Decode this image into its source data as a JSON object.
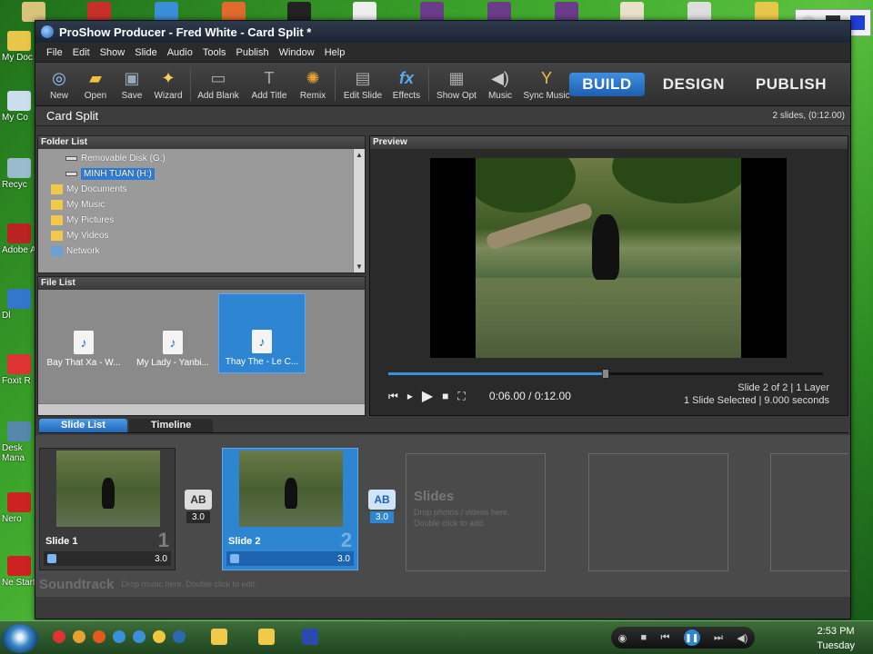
{
  "window": {
    "title": "ProShow Producer - Fred White - Card Split *"
  },
  "menu": [
    "File",
    "Edit",
    "Show",
    "Slide",
    "Audio",
    "Tools",
    "Publish",
    "Window",
    "Help"
  ],
  "toolbar": {
    "buttons": [
      {
        "label": "New",
        "icon": "new-disc-icon"
      },
      {
        "label": "Open",
        "icon": "folder-open-icon"
      },
      {
        "label": "Save",
        "icon": "floppy-save-icon"
      },
      {
        "label": "Wizard",
        "icon": "wizard-icon"
      },
      {
        "label": "Add Blank",
        "icon": "add-blank-icon"
      },
      {
        "label": "Add Title",
        "icon": "add-title-icon"
      },
      {
        "label": "Remix",
        "icon": "remix-icon"
      },
      {
        "label": "Edit Slide",
        "icon": "edit-slide-icon"
      },
      {
        "label": "Effects",
        "icon": "effects-fx-icon"
      },
      {
        "label": "Show Opt",
        "icon": "show-options-icon"
      },
      {
        "label": "Music",
        "icon": "music-speaker-icon"
      },
      {
        "label": "Sync Music",
        "icon": "sync-music-icon"
      }
    ],
    "modes": [
      "BUILD",
      "DESIGN",
      "PUBLISH"
    ],
    "active_mode": "BUILD"
  },
  "show": {
    "title": "Card Split",
    "info": "2 slides, (0:12.00)"
  },
  "folder_list": {
    "header": "Folder List",
    "items": [
      {
        "label": "Removable Disk (G:)",
        "icon": "drive-icon"
      },
      {
        "label": "MINH TUAN (H:)",
        "icon": "drive-icon",
        "selected": true
      },
      {
        "label": "My Documents",
        "icon": "folder-icon"
      },
      {
        "label": "My Music",
        "icon": "folder-icon"
      },
      {
        "label": "My Pictures",
        "icon": "folder-icon"
      },
      {
        "label": "My Videos",
        "icon": "folder-icon"
      },
      {
        "label": "Network",
        "icon": "network-icon"
      }
    ]
  },
  "file_list": {
    "header": "File List",
    "files": [
      {
        "name": "Bay That Xa - W...",
        "type": "MP3"
      },
      {
        "name": "My Lady - Yanbi...",
        "type": "MP3"
      },
      {
        "name": "Thay The - Le C...",
        "type": "MP3",
        "selected": true
      }
    ]
  },
  "preview": {
    "header": "Preview",
    "time": "0:06.00 / 0:12.00",
    "progress": 0.5,
    "slide_info": "Slide 2 of 2 | 1 Layer",
    "selection_info": "1 Slide Selected | 9.000 seconds"
  },
  "slide_list": {
    "tabs": [
      "Slide List",
      "Timeline"
    ],
    "active_tab": "Slide List",
    "slides": [
      {
        "label": "Slide 1",
        "number": "1",
        "duration": "3.0"
      },
      {
        "label": "Slide 2",
        "number": "2",
        "duration": "3.0",
        "selected": true
      }
    ],
    "transitions": [
      "3.0",
      "3.0"
    ],
    "empty_title": "Slides",
    "empty_hint_1": "Drop photos / videos here.",
    "empty_hint_2": "Double click to add.",
    "soundtrack_label": "Soundtrack",
    "soundtrack_hint": "Drop music here.  Double click to edit."
  },
  "taskbar": {
    "clock_time": "2:53 PM",
    "clock_day": "Tuesday"
  },
  "desktop": {
    "left_icons": [
      "My Doc",
      "My Co",
      "Recyc",
      "Adobe A",
      "Dl",
      "Foxit R",
      "Desk Mana",
      "Nero",
      "Ne Start"
    ]
  },
  "colors": {
    "accent": "#2e86d3",
    "app_bg": "#3a3a3a"
  }
}
